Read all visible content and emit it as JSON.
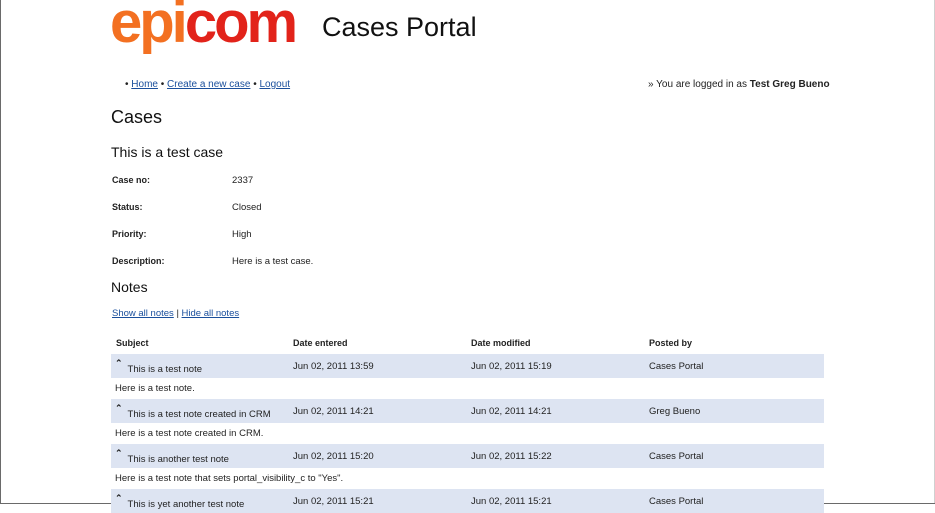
{
  "header": {
    "logo_part1": "epi",
    "logo_part2": "com",
    "portal_title": "Cases Portal"
  },
  "nav": {
    "links": [
      "Home",
      "Create a new case",
      "Logout"
    ],
    "login_prefix": "» You are logged in as ",
    "login_user": "Test Greg Bueno"
  },
  "page": {
    "title": "Cases",
    "case_title": "This is a test case"
  },
  "case_details": [
    {
      "label": "Case no:",
      "value": "2337"
    },
    {
      "label": "Status:",
      "value": "Closed"
    },
    {
      "label": "Priority:",
      "value": "High"
    },
    {
      "label": "Description:",
      "value": "Here is a test case."
    }
  ],
  "notes": {
    "title": "Notes",
    "show_all": "Show all notes",
    "separator": "|",
    "hide_all": "Hide all notes",
    "columns": [
      "Subject",
      "Date entered",
      "Date modified",
      "Posted by"
    ],
    "rows": [
      {
        "subject": "This is a test note",
        "date_entered": "Jun 02, 2011 13:59",
        "date_modified": "Jun 02, 2011 15:19",
        "posted_by": "Cases Portal",
        "body": "Here is a test note."
      },
      {
        "subject": "This is a test note created in CRM",
        "date_entered": "Jun 02, 2011 14:21",
        "date_modified": "Jun 02, 2011 14:21",
        "posted_by": "Greg Bueno",
        "body": "Here is a test note created in CRM."
      },
      {
        "subject": "This is another test note",
        "date_entered": "Jun 02, 2011 15:20",
        "date_modified": "Jun 02, 2011 15:22",
        "posted_by": "Cases Portal",
        "body": "Here is a test note that sets portal_visibility_c to \"Yes\"."
      },
      {
        "subject": "This is yet another test note",
        "date_entered": "Jun 02, 2011 15:21",
        "date_modified": "Jun 02, 2011 15:21",
        "posted_by": "Cases Portal",
        "body": ""
      }
    ]
  }
}
